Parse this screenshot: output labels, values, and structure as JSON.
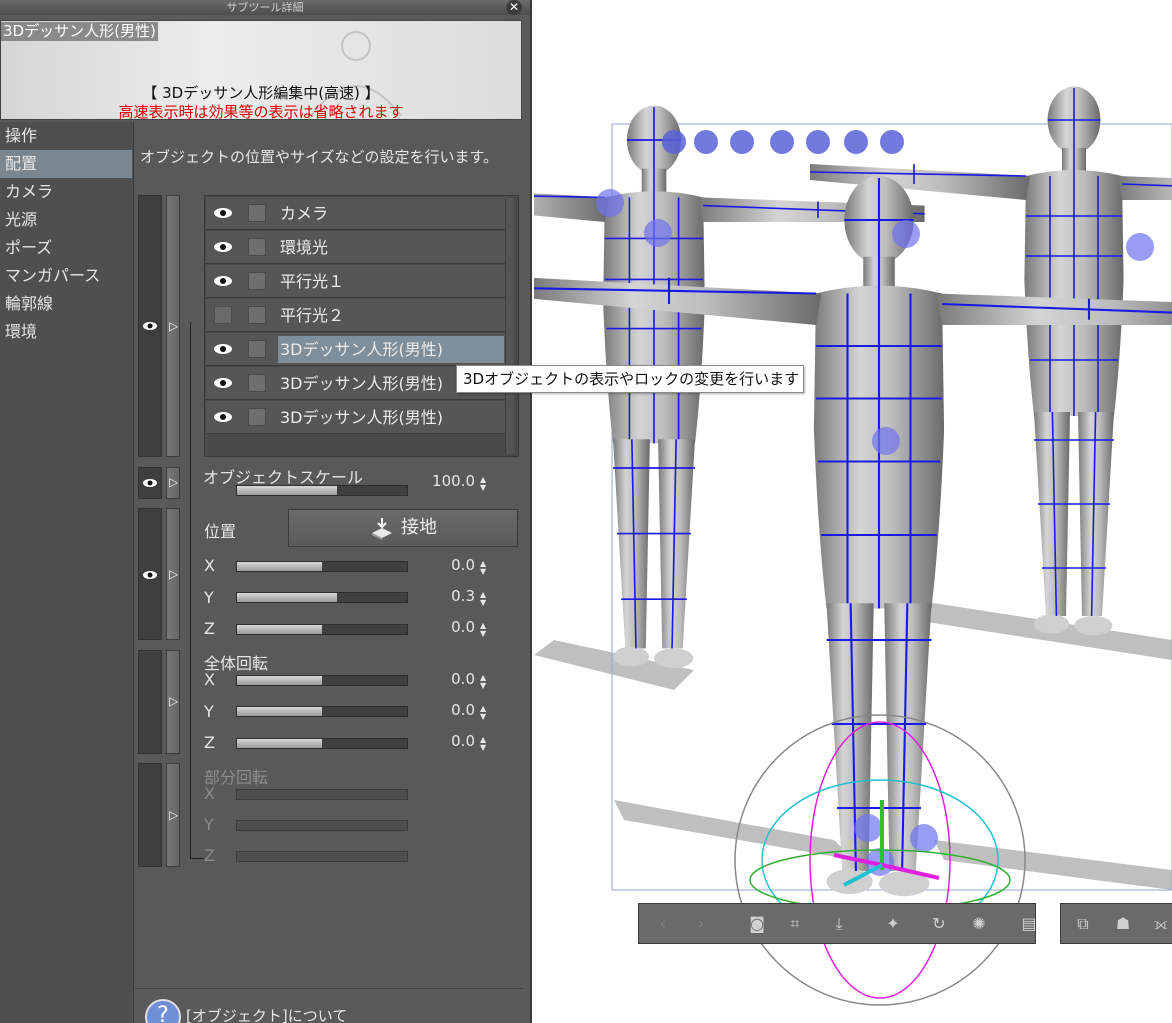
{
  "window": {
    "title": "サブツール詳細",
    "close_icon": "close-icon"
  },
  "preview": {
    "tag": "3Dデッサン人形(男性)",
    "line1": "【 3Dデッサン人形編集中(高速) 】",
    "line2": "高速表示時は効果等の表示は省略されます"
  },
  "categories": [
    "操作",
    "配置",
    "カメラ",
    "光源",
    "ポーズ",
    "マンガパース",
    "輪郭線",
    "環境"
  ],
  "selected_category": "配置",
  "description": "オブジェクトの位置やサイズなどの設定を行います。",
  "objects": [
    {
      "name": "カメラ",
      "visible": true
    },
    {
      "name": "環境光",
      "visible": true
    },
    {
      "name": "平行光１",
      "visible": true
    },
    {
      "name": "平行光２",
      "visible": false
    },
    {
      "name": "3Dデッサン人形(男性)",
      "visible": true,
      "selected": true
    },
    {
      "name": "3Dデッサン人形(男性)",
      "visible": true
    },
    {
      "name": "3Dデッサン人形(男性)",
      "visible": true
    }
  ],
  "scale": {
    "label": "オブジェクトスケール",
    "value": "100.0",
    "level": 0.59
  },
  "position": {
    "label": "位置",
    "ground_button": "接地",
    "x": {
      "label": "X",
      "value": "0.0",
      "level": 0.5
    },
    "y": {
      "label": "Y",
      "value": "0.3",
      "level": 0.59
    },
    "z": {
      "label": "Z",
      "value": "0.0",
      "level": 0.5
    }
  },
  "rotation": {
    "label": "全体回転",
    "x": {
      "label": "X",
      "value": "0.0",
      "level": 0.5
    },
    "y": {
      "label": "Y",
      "value": "0.0",
      "level": 0.5
    },
    "z": {
      "label": "Z",
      "value": "0.0",
      "level": 0.5
    }
  },
  "partial_rotation": {
    "label": "部分回転",
    "x": {
      "label": "X"
    },
    "y": {
      "label": "Y"
    },
    "z": {
      "label": "Z"
    }
  },
  "help_text": "[オブジェクト]について",
  "tooltip": "3Dオブジェクトの表示やロックの変更を行います",
  "colors": {
    "selection": "#7e8e9a",
    "warning": "#e00000",
    "model_lines": "#1a1ae6",
    "handle": "#6f74ee"
  }
}
